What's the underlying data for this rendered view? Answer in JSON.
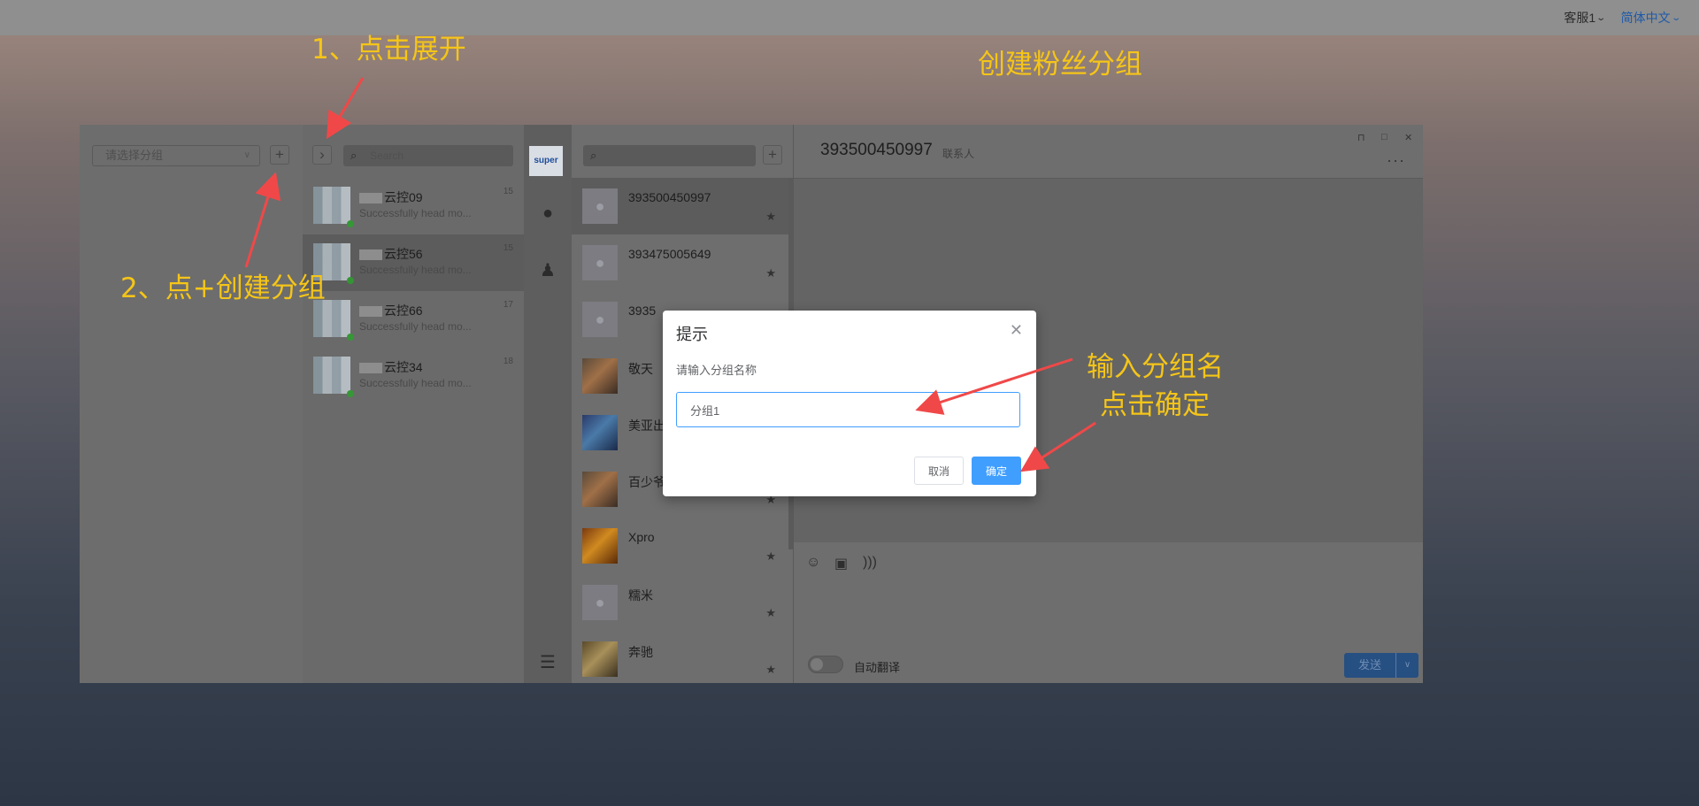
{
  "topbar": {
    "agent": "客服1",
    "language": "简体中文"
  },
  "annotations": {
    "step1": "1、点击展开",
    "step2": "2、点+创建分组",
    "headline": "创建粉丝分组",
    "step3_line1": "输入分组名",
    "step3_line2": "点击确定"
  },
  "group_panel": {
    "select_placeholder": "请选择分组",
    "add_label": "+"
  },
  "chat_panel": {
    "expand_label": "›",
    "search_placeholder": "Search",
    "chats": [
      {
        "name": "云控09",
        "preview": "Successfully head mo...",
        "time": "15"
      },
      {
        "name": "云控56",
        "preview": "Successfully head mo...",
        "time": "15"
      },
      {
        "name": "云控66",
        "preview": "Successfully head mo...",
        "time": "17"
      },
      {
        "name": "云控34",
        "preview": "Successfully head mo...",
        "time": "18"
      }
    ]
  },
  "sidebar": {
    "logo_text": "super"
  },
  "contact_panel": {
    "add_label": "+",
    "contacts": [
      {
        "name": "393500450997"
      },
      {
        "name": "393475005649"
      },
      {
        "name": "3935"
      },
      {
        "name": "敬天"
      },
      {
        "name": "美亚出"
      },
      {
        "name": "百少爷"
      },
      {
        "name": "Xpro"
      },
      {
        "name": "糯米"
      },
      {
        "name": "奔驰"
      }
    ]
  },
  "conversation": {
    "title": "393500450997",
    "subtitle": "联系人",
    "auto_translate_label": "自动翻译",
    "send_label": "发送"
  },
  "dialog": {
    "title": "提示",
    "message": "请输入分组名称",
    "input_value": "分组1",
    "cancel_label": "取消",
    "confirm_label": "确定"
  },
  "colors": {
    "annotation": "#f5c518",
    "arrow": "#f04848",
    "primary": "#409eff"
  }
}
